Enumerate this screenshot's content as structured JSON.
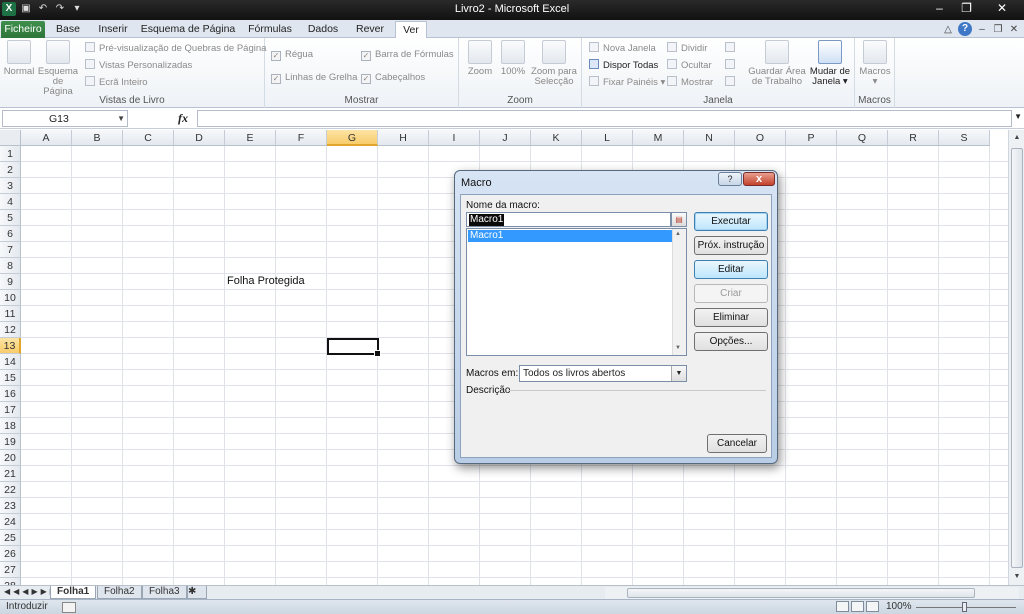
{
  "window": {
    "title": "Livro2 - Microsoft Excel",
    "qat_icons": [
      "excel-logo-icon",
      "save-icon",
      "undo-icon",
      "redo-icon",
      "customize-qat-icon"
    ],
    "controls": [
      "minimize",
      "maximize",
      "close"
    ]
  },
  "tabs": [
    {
      "label": "Ficheiro"
    },
    {
      "label": "Base"
    },
    {
      "label": "Inserir"
    },
    {
      "label": "Esquema de Página"
    },
    {
      "label": "Fórmulas"
    },
    {
      "label": "Dados"
    },
    {
      "label": "Rever"
    },
    {
      "label": "Ver"
    }
  ],
  "active_tab": "Ver",
  "ribbon": {
    "vistas_livro": {
      "label": "Vistas de Livro",
      "normal": "Normal",
      "esquema1": "Esquema",
      "esquema2": "de Página",
      "previsualizacao": "Pré-visualização de Quebras de Página",
      "vistas_pers": "Vistas Personalizadas",
      "ecra_inteiro": "Ecrã Inteiro"
    },
    "mostrar": {
      "label": "Mostrar",
      "regua": "Régua",
      "linhas_grelha": "Linhas de Grelha",
      "barra_formulas": "Barra de Fórmulas",
      "cabecalhos": "Cabeçalhos"
    },
    "zoom": {
      "label": "Zoom",
      "zoom": "Zoom",
      "cem": "100%",
      "selecao1": "Zoom para",
      "selecao2": "Selecção"
    },
    "janela": {
      "label": "Janela",
      "nova": "Nova Janela",
      "dispor": "Dispor Todas",
      "fixar": "Fixar Painéis",
      "dividir": "Dividir",
      "ocultar": "Ocultar",
      "mostrar": "Mostrar",
      "guardar1": "Guardar Área",
      "guardar2": "de Trabalho",
      "mudar1": "Mudar de",
      "mudar2": "Janela"
    },
    "macros": {
      "label": "Macros",
      "macros": "Macros"
    }
  },
  "formula_bar": {
    "name_box": "G13",
    "fx": "fx",
    "content": ""
  },
  "columns": [
    "A",
    "B",
    "C",
    "D",
    "E",
    "F",
    "G",
    "H",
    "I",
    "J",
    "K",
    "L",
    "M",
    "N",
    "O",
    "P",
    "Q",
    "R",
    "S"
  ],
  "rows": [
    "1",
    "2",
    "3",
    "4",
    "5",
    "6",
    "7",
    "8",
    "9",
    "10",
    "11",
    "12",
    "13",
    "14",
    "15",
    "16",
    "17",
    "18",
    "19",
    "20",
    "21",
    "22",
    "23",
    "24",
    "25",
    "26",
    "27",
    "28"
  ],
  "selected_column": "G",
  "selected_row": "13",
  "cell_E9": "Folha Protegida",
  "sheets": [
    "Folha1",
    "Folha2",
    "Folha3"
  ],
  "active_sheet": "Folha1",
  "status": {
    "mode": "Introduzir",
    "zoom": "100%"
  },
  "dialog": {
    "title": "Macro",
    "help": "?",
    "close": "x",
    "name_label": "Nome da macro:",
    "name_value": "Macro1",
    "list_items": [
      "Macro1"
    ],
    "macros_in_label": "Macros em:",
    "macros_in_value": "Todos os livros abertos",
    "description_label": "Descrição",
    "buttons": {
      "executar": "Executar",
      "prox": "Próx. instrução",
      "editar": "Editar",
      "criar": "Criar",
      "eliminar": "Eliminar",
      "opcoes": "Opções...",
      "cancelar": "Cancelar"
    }
  }
}
